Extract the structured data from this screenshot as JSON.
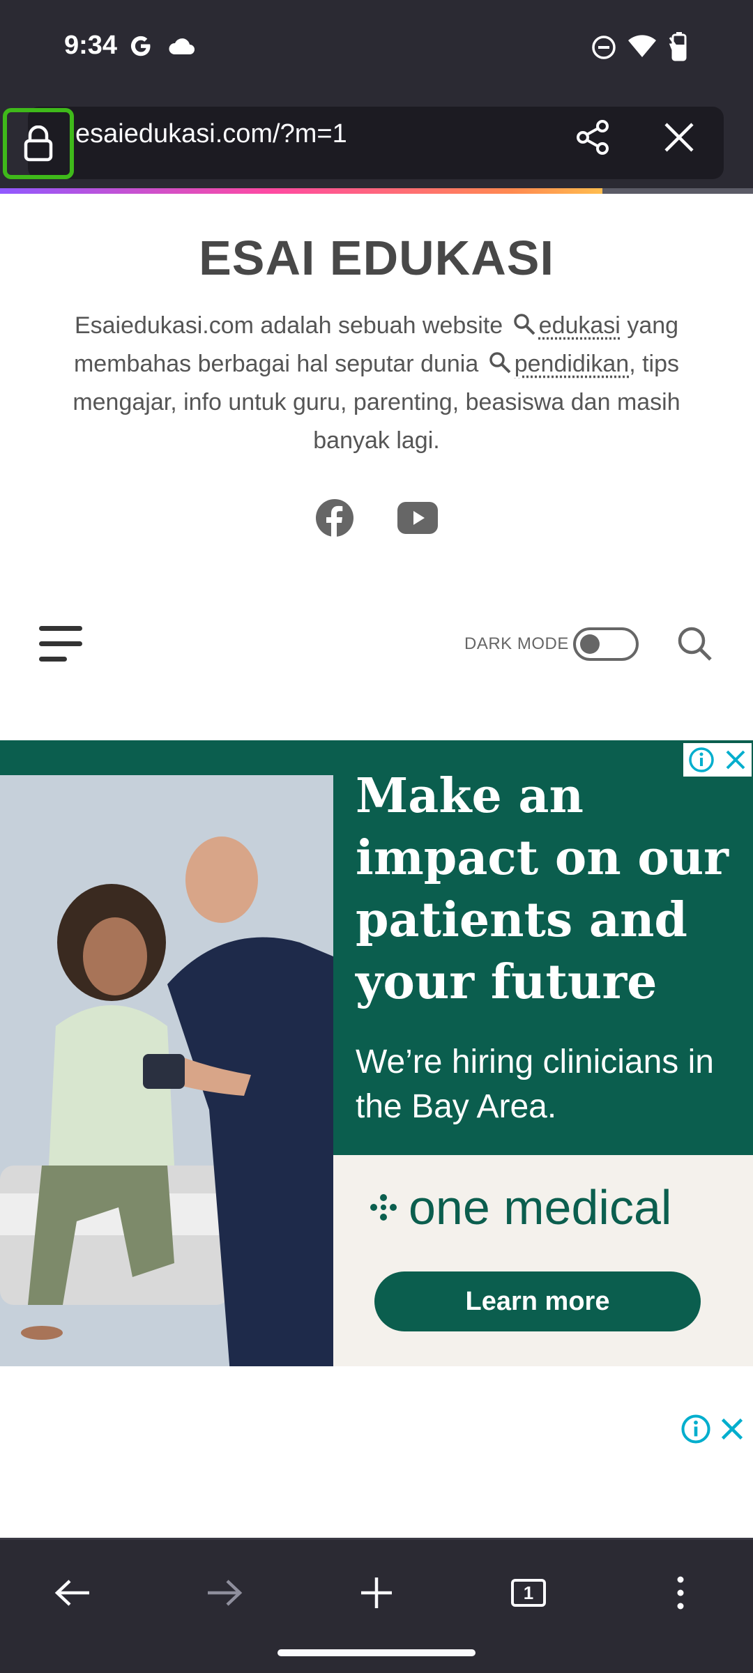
{
  "status_bar": {
    "time": "9:34",
    "icons": [
      "google-icon",
      "cloud-icon",
      "dnd-icon",
      "wifi-icon",
      "battery-icon"
    ]
  },
  "browser": {
    "url": "esaiedukasi.com/?m=1",
    "load_progress": 0.8,
    "accent_lock_highlight": "#3fb91a"
  },
  "page": {
    "title": "ESAI EDUKASI",
    "description": {
      "part1": "Esaiedukasi.com adalah sebuah website",
      "kw1": "edukasi",
      "part2": "yang membahas berbagai hal seputar dunia",
      "kw2": "pendidikan",
      "part3": ", tips mengajar, info untuk guru, parenting, beasiswa dan masih banyak lagi."
    },
    "social": [
      "facebook-icon",
      "youtube-icon"
    ],
    "dark_mode_label": "DARK MODE",
    "dark_mode_on": false
  },
  "ad": {
    "headline": "Make an impact on our patients and your future",
    "subtext": "We’re hiring clinicians in the Bay Area.",
    "brand": "one medical",
    "cta": "Learn more",
    "brand_color": "#0b5e4e"
  },
  "bottom_nav": {
    "tab_count": "1"
  }
}
